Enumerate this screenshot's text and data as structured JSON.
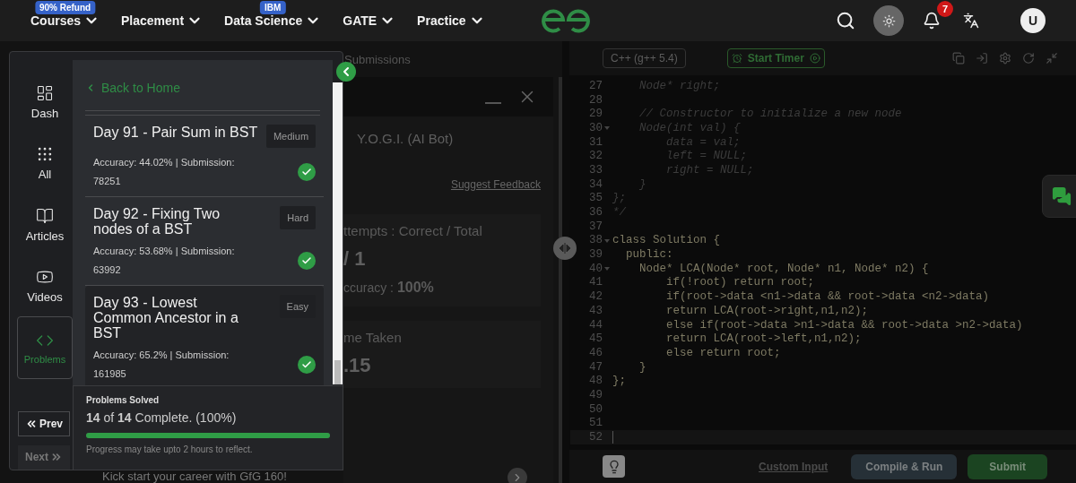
{
  "nav": {
    "items": [
      {
        "label": "Courses",
        "badge": "90% Refund"
      },
      {
        "label": "Placement"
      },
      {
        "label": "Data Science",
        "badge": "IBM"
      },
      {
        "label": "GATE"
      },
      {
        "label": "Practice"
      }
    ],
    "notifications": "7",
    "avatar": "U"
  },
  "background": {
    "tab": "Submissions",
    "bot_title": "Y.O.G.I. (AI Bot)",
    "feedback": "Suggest Feedback",
    "cards": [
      {
        "label": "ttempts : Correct / Total",
        "value": "/ 1",
        "sub_label": "ccuracy : ",
        "sub_value": "100%"
      },
      {
        "label": "me Taken",
        "value": ".15"
      }
    ],
    "banner": "Kick start your career with GfG 160!"
  },
  "sidebar": {
    "rail": [
      {
        "label": "Dash",
        "selected": false
      },
      {
        "label": "All",
        "selected": false
      },
      {
        "label": "Articles",
        "selected": false
      },
      {
        "label": "Videos",
        "selected": false
      },
      {
        "label": "Problems",
        "selected": true
      }
    ],
    "prev": {
      "label": "Prev",
      "disabled": false
    },
    "next": {
      "label": "Next",
      "disabled": true
    },
    "back": "Back to Home",
    "problems": [
      {
        "title": "Day 91 - Pair Sum in BST",
        "difficulty": "Medium",
        "stats": "Accuracy: 44.02% | Submission: 78251",
        "solved": true,
        "selected": false
      },
      {
        "title": "Day 92 - Fixing Two nodes of a BST",
        "difficulty": "Hard",
        "stats": "Accuracy: 53.68% | Submission: 63992",
        "solved": true,
        "selected": false
      },
      {
        "title": "Day 93 - Lowest Common Ancestor in a BST",
        "difficulty": "Easy",
        "stats": "Accuracy: 65.2% | Submission: 161985",
        "solved": true,
        "selected": true
      }
    ],
    "progress": {
      "title": "Problems Solved",
      "summary": "**14** of **14** Complete. (100%)",
      "level": 1,
      "note": "Progress may take upto 2 hours to reflect."
    }
  },
  "editor": {
    "language": "C++ (g++ 5.4)",
    "timer": "Start Timer",
    "lines": [
      {
        "number": "27",
        "text": "    Node* right;",
        "kind": "comment"
      },
      {
        "number": "28",
        "kind": "comment"
      },
      {
        "number": "29",
        "text": "    // Constructor to initialize a new node",
        "kind": "comment"
      },
      {
        "number": "30",
        "text": "    Node(int val) {",
        "kind": "comment",
        "fold": true
      },
      {
        "number": "31",
        "text": "        data = val;",
        "kind": "comment"
      },
      {
        "number": "32",
        "text": "        left = NULL;",
        "kind": "comment"
      },
      {
        "number": "33",
        "text": "        right = NULL;",
        "kind": "comment"
      },
      {
        "number": "34",
        "text": "    }",
        "kind": "comment"
      },
      {
        "number": "35",
        "text": "};",
        "kind": "comment"
      },
      {
        "number": "36",
        "text": "*/",
        "kind": "comment"
      },
      {
        "number": "37",
        "kind": "code"
      },
      {
        "number": "38",
        "text": "class Solution {",
        "kind": "code",
        "fold": true
      },
      {
        "number": "39",
        "text": "  public:",
        "kind": "code"
      },
      {
        "number": "40",
        "text": "    Node* LCA(Node* root, Node* n1, Node* n2) {",
        "kind": "code",
        "fold": true
      },
      {
        "number": "41",
        "text": "        if(!root) return root;",
        "kind": "code"
      },
      {
        "number": "42",
        "text": "        if(root->data <n1->data && root->data <n2->data)",
        "kind": "code"
      },
      {
        "number": "43",
        "text": "        return LCA(root->right,n1,n2);",
        "kind": "code"
      },
      {
        "number": "44",
        "text": "        else if(root->data >n1->data && root->data >n2->data)",
        "kind": "code"
      },
      {
        "number": "45",
        "text": "        return LCA(root->left,n1,n2);",
        "kind": "code"
      },
      {
        "number": "46",
        "text": "        else return root;",
        "kind": "code"
      },
      {
        "number": "47",
        "text": "    }",
        "kind": "code"
      },
      {
        "number": "48",
        "text": "};",
        "kind": "code"
      },
      {
        "number": "49",
        "kind": "code"
      },
      {
        "number": "50",
        "kind": "code"
      },
      {
        "number": "51",
        "kind": "code"
      },
      {
        "number": "52",
        "kind": "code",
        "current": true
      }
    ],
    "custom_input": "Custom Input",
    "run": "Compile & Run",
    "submit": "Submit"
  }
}
